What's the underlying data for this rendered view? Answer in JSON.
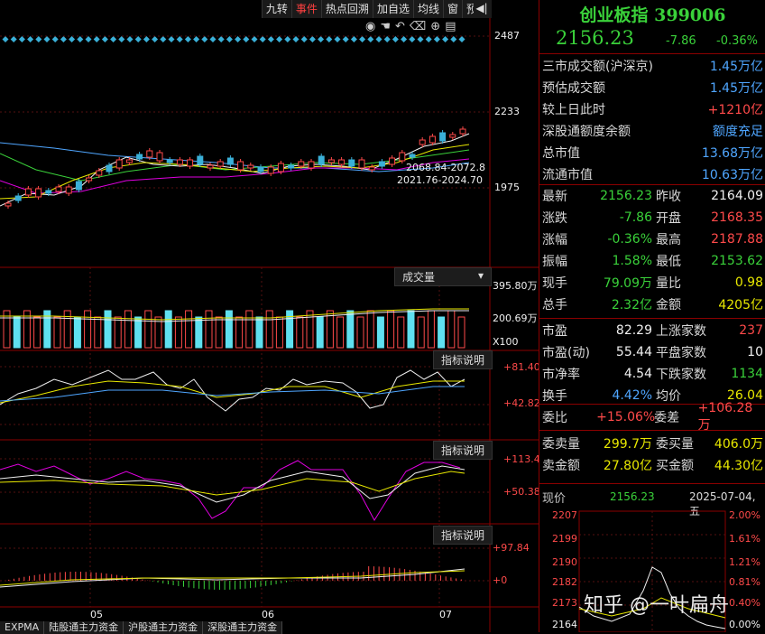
{
  "toolbar": {
    "tabs": [
      "九转",
      "事件",
      "热点回溯",
      "加自选",
      "均线",
      "窗",
      "预测"
    ]
  },
  "chart": {
    "price_axis": [
      "2487",
      "2233",
      "1975"
    ],
    "ma_labels": [
      "2068.84-2072.8",
      "2021.76-2024.70"
    ],
    "volume_label": "成交量",
    "volume_axis": [
      "395.80万",
      "200.69万",
      "X100"
    ],
    "indicator_label": "指标说明",
    "ind1_axis": [
      "+81.40",
      "+42.82"
    ],
    "ind2_axis": [
      "+113.4",
      "+50.38"
    ],
    "ind3_axis": [
      "+97.84",
      "+0"
    ],
    "months": [
      "05",
      "06",
      "07"
    ],
    "bottom_tabs": [
      "EXPMA",
      "陆股通主力资金",
      "沪股通主力资金",
      "深股通主力资金"
    ]
  },
  "info": {
    "title": "创业板指 399006",
    "price": "2156.23",
    "change": "-7.86",
    "change_pct": "-0.36%",
    "market_rows": [
      {
        "label": "三市成交额(沪深京)",
        "value": "1.45万亿"
      },
      {
        "label": "预估成交额",
        "value": "1.45万亿"
      },
      {
        "label": "较上日此时",
        "value": "+1210亿"
      },
      {
        "label": "深股通额度余额",
        "value": "额度充足"
      },
      {
        "label": "总市值",
        "value": "13.68万亿"
      },
      {
        "label": "流通市值",
        "value": "10.63万亿"
      }
    ],
    "quote_rows": [
      {
        "l1": "最新",
        "v1": "2156.23",
        "l2": "昨收",
        "v2": "2164.09"
      },
      {
        "l1": "涨跌",
        "v1": "-7.86",
        "l2": "开盘",
        "v2": "2168.35"
      },
      {
        "l1": "涨幅",
        "v1": "-0.36%",
        "l2": "最高",
        "v2": "2187.88"
      },
      {
        "l1": "振幅",
        "v1": "1.58%",
        "l2": "最低",
        "v2": "2153.62"
      },
      {
        "l1": "现手",
        "v1": "79.09万",
        "l2": "量比",
        "v2": "0.98"
      },
      {
        "l1": "总手",
        "v1": "2.32亿",
        "l2": "金额",
        "v2": "4205亿"
      }
    ],
    "stat_rows": [
      {
        "l1": "市盈",
        "v1": "82.29",
        "l2": "上涨家数",
        "v2": "237"
      },
      {
        "l1": "市盈(动)",
        "v1": "55.44",
        "l2": "平盘家数",
        "v2": "10"
      },
      {
        "l1": "市净率",
        "v1": "4.54",
        "l2": "下跌家数",
        "v2": "1134"
      },
      {
        "l1": "换手",
        "v1": "4.42%",
        "l2": "均价",
        "v2": "26.04"
      }
    ],
    "ratio_row": {
      "l1": "委比",
      "v1": "+15.06%",
      "l2": "委差",
      "v2": "+106.28万"
    },
    "order_rows": [
      {
        "l1": "委卖量",
        "v1": "299.7万",
        "l2": "委买量",
        "v2": "406.0万"
      },
      {
        "l1": "卖金额",
        "v1": "27.80亿",
        "l2": "买金额",
        "v2": "44.30亿"
      }
    ],
    "mini": {
      "label": "现价",
      "price": "2156.23",
      "date": "2025-07-04,五",
      "left_axis": [
        "2207",
        "2199",
        "2190",
        "2182",
        "2173",
        "2164"
      ],
      "right_axis": [
        "2.00%",
        "1.61%",
        "1.21%",
        "0.81%",
        "0.40%",
        "0.00%"
      ]
    },
    "watermark": "知乎 @一叶扁舟"
  }
}
